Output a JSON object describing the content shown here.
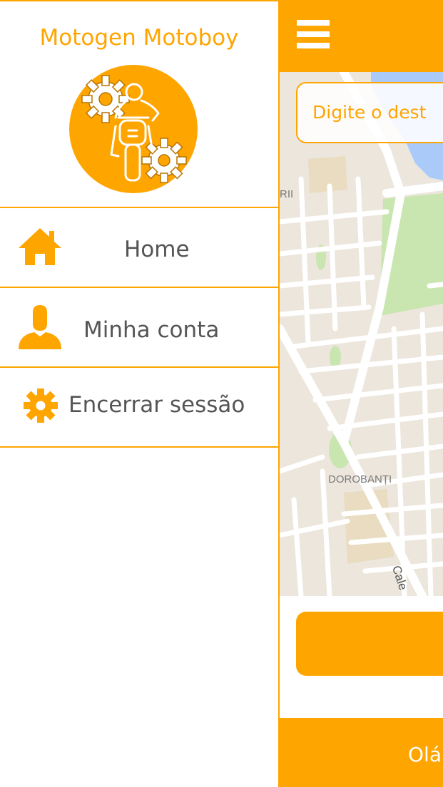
{
  "theme": {
    "accent": "#FFA500",
    "text": "#555555",
    "map_bg": "#ece6dd"
  },
  "drawer": {
    "title": "Motogen Motoboy",
    "logo_icon": "motorcycle-gears-logo",
    "menu": [
      {
        "label": "Home",
        "icon": "home-icon"
      },
      {
        "label": "Minha conta",
        "icon": "user-icon"
      },
      {
        "label": "Encerrar sessão",
        "icon": "gear-icon"
      }
    ]
  },
  "app": {
    "menu_icon": "hamburger-icon",
    "search": {
      "placeholder": "Digite o dest"
    },
    "map": {
      "labels": {
        "district": "DOROBANȚI",
        "district_partial": "RII",
        "street": "Cale"
      }
    },
    "bottom": {
      "text": "Olá"
    }
  }
}
